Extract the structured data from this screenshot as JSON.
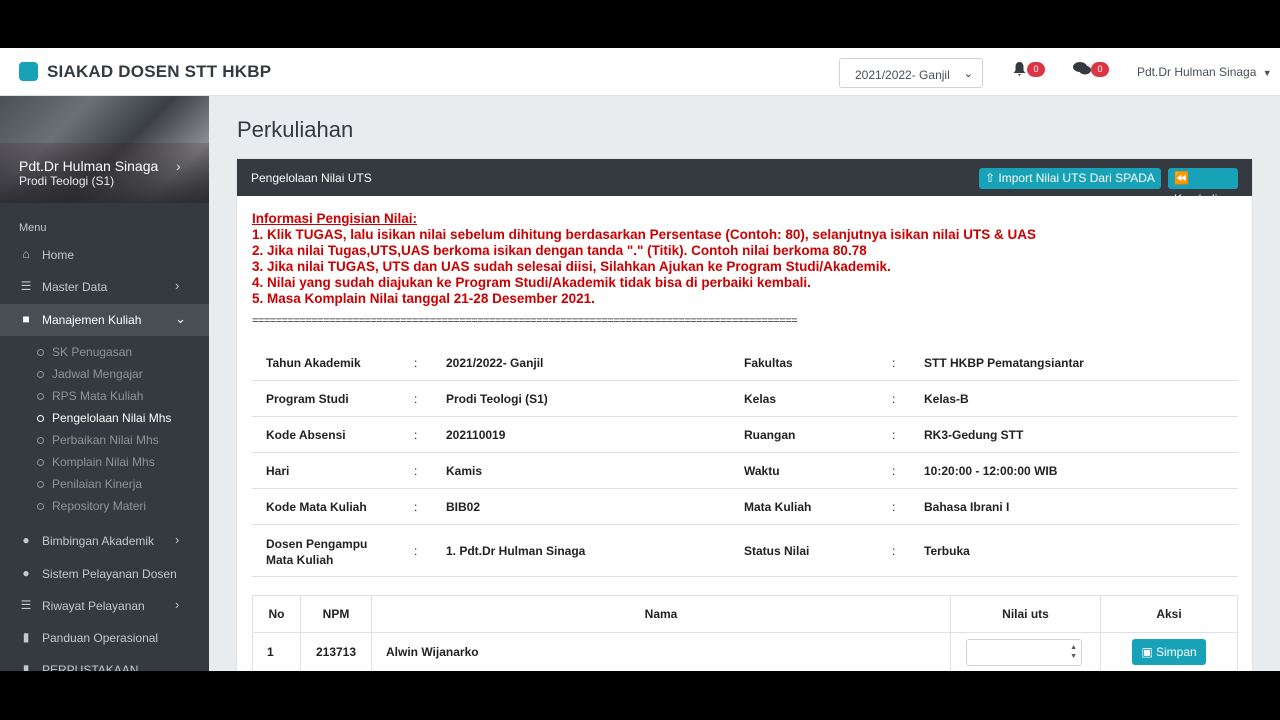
{
  "header": {
    "brand": "SIAKAD DOSEN STT HKBP",
    "semester_select": "2021/2022- Ganjil",
    "notif_count": "0",
    "message_count": "0",
    "user_name": "Pdt.Dr Hulman Sinaga"
  },
  "sidebar": {
    "profile_name": "Pdt.Dr Hulman Sinaga",
    "profile_prodi": "Prodi Teologi (S1)",
    "menu_label": "Menu",
    "items": [
      {
        "label": "Home"
      },
      {
        "label": "Master Data"
      },
      {
        "label": "Manajemen Kuliah"
      },
      {
        "label": "Bimbingan Akademik"
      },
      {
        "label": "Sistem Pelayanan Dosen"
      },
      {
        "label": "Riwayat Pelayanan"
      },
      {
        "label": "Panduan Operasional"
      },
      {
        "label": "PERPUSTAKAAN"
      }
    ],
    "sub_items": [
      {
        "label": "SK Penugasan"
      },
      {
        "label": "Jadwal Mengajar"
      },
      {
        "label": "RPS Mata Kuliah"
      },
      {
        "label": "Pengelolaan Nilai Mhs"
      },
      {
        "label": "Perbaikan Nilai Mhs"
      },
      {
        "label": "Komplain Nilai Mhs"
      },
      {
        "label": "Penilaian Kinerja"
      },
      {
        "label": "Repository Materi"
      }
    ]
  },
  "main": {
    "page_title": "Perkuliahan",
    "card_title": "Pengelolaan Nilai UTS",
    "import_button": "Import Nilai UTS Dari SPADA",
    "back_button": "Kembali",
    "info_title": "Informasi Pengisian Nilai:",
    "info_lines": [
      "1. Klik TUGAS, lalu isikan nilai sebelum dihitung berdasarkan Persentase (Contoh: 80), selanjutnya isikan nilai UTS & UAS",
      "2. Jika nilai Tugas,UTS,UAS berkoma isikan dengan tanda \".\" (Titik). Contoh nilai berkoma 80.78",
      "3. Jika nilai TUGAS, UTS dan UAS sudah selesai diisi, Silahkan Ajukan ke Program Studi/Akademik.",
      "4. Nilai yang sudah diajukan ke Program Studi/Akademik tidak bisa di perbaiki kembali.",
      "5. Masa Komplain Nilai tanggal 21-28 Desember 2021."
    ],
    "separator": "============================================================================================",
    "details": [
      {
        "l1": "Tahun Akademik",
        "v1": "2021/2022- Ganjil",
        "l2": "Fakultas",
        "v2": "STT HKBP Pematangsiantar"
      },
      {
        "l1": "Program Studi",
        "v1": "Prodi Teologi (S1)",
        "l2": "Kelas",
        "v2": "Kelas-B"
      },
      {
        "l1": "Kode Absensi",
        "v1": "202110019",
        "l2": "Ruangan",
        "v2": "RK3-Gedung STT"
      },
      {
        "l1": "Hari",
        "v1": "Kamis",
        "l2": "Waktu",
        "v2": "10:20:00 - 12:00:00 WIB"
      },
      {
        "l1": "Kode Mata Kuliah",
        "v1": "BIB02",
        "l2": "Mata Kuliah",
        "v2": "Bahasa Ibrani I"
      },
      {
        "l1": "Dosen Pengampu Mata Kuliah",
        "v1": "1. Pdt.Dr Hulman Sinaga",
        "l2": "Status Nilai",
        "v2": "Terbuka"
      }
    ],
    "colon": ":",
    "table": {
      "headers": [
        "No",
        "NPM",
        "Nama",
        "Nilai uts",
        "Aksi"
      ],
      "rows": [
        {
          "no": "1",
          "npm": "213713",
          "nama": "Alwin Wijanarko",
          "nilai": "",
          "action": "Simpan"
        }
      ]
    }
  }
}
